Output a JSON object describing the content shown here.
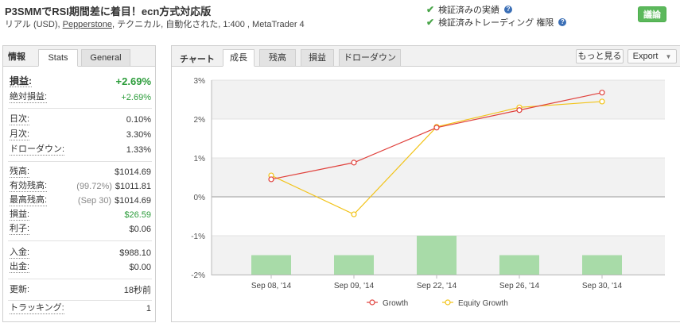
{
  "header": {
    "title": "P3SMMでRSI期間差に着目！ecn方式対応版",
    "subtitle_pre": "リアル (USD), ",
    "broker": "Pepperstone",
    "subtitle_post": ", テクニカル, 自動化された, 1:400 , MetaTrader 4",
    "verified_track": "検証済みの実績",
    "verified_trading": "検証済みトレーディング 権限",
    "discuss_button": "議論"
  },
  "info": {
    "tab_title": "情報",
    "tabs": [
      "Stats",
      "General"
    ],
    "rows": {
      "gain": {
        "label": "損益:",
        "value": "+2.69%"
      },
      "abs_gain": {
        "label": "絶対損益:",
        "value": "+2.69%"
      },
      "daily": {
        "label": "日次:",
        "value": "0.10%"
      },
      "monthly": {
        "label": "月次:",
        "value": "3.30%"
      },
      "drawdown": {
        "label": "ドローダウン:",
        "value": "1.33%"
      },
      "balance": {
        "label": "残高:",
        "value": "$1014.69"
      },
      "equity": {
        "label": "有効残高:",
        "pre": "(99.72%)",
        "value": "$1011.81"
      },
      "highest": {
        "label": "最高残高:",
        "pre": "(Sep 30)",
        "value": "$1014.69"
      },
      "profit": {
        "label": "損益:",
        "value": "$26.59"
      },
      "interest": {
        "label": "利子:",
        "value": "$0.06"
      },
      "deposits": {
        "label": "入金:",
        "value": "$988.10"
      },
      "withdrawals": {
        "label": "出金:",
        "value": "$0.00"
      },
      "updated": {
        "label": "更新:",
        "value": "18秒前"
      },
      "tracking": {
        "label": "トラッキング:",
        "value": "1"
      }
    },
    "colors": {
      "positive": "#2b9c3a"
    }
  },
  "chart_panel": {
    "tab_title": "チャート",
    "tabs": [
      "成長",
      "残高",
      "損益",
      "ドローダウン"
    ],
    "active_tab": "成長",
    "more_button": "もっと見る",
    "export_button": "Export"
  },
  "chart_data": {
    "type": "line",
    "title": "",
    "xlabel": "",
    "ylabel": "",
    "categories": [
      "Sep 08, '14",
      "Sep 09, '14",
      "Sep 22, '14",
      "Sep 26, '14",
      "Sep 30, '14"
    ],
    "series": [
      {
        "name": "Growth",
        "type": "line",
        "color": "#e0413c",
        "values": [
          0.45,
          0.88,
          1.78,
          2.23,
          2.68
        ]
      },
      {
        "name": "Equity Growth",
        "type": "line",
        "color": "#f2c318",
        "values": [
          0.55,
          -0.45,
          1.8,
          2.3,
          2.45
        ]
      },
      {
        "name": "",
        "type": "bar",
        "color": "#a8dba8",
        "values": [
          -1.5,
          -1.5,
          -1.0,
          -1.5,
          -1.5
        ]
      }
    ],
    "ylim": [
      -2,
      3
    ],
    "yticks": [
      "-2%",
      "-1%",
      "0%",
      "1%",
      "2%",
      "3%"
    ],
    "grid": true,
    "legend": "bottom"
  }
}
